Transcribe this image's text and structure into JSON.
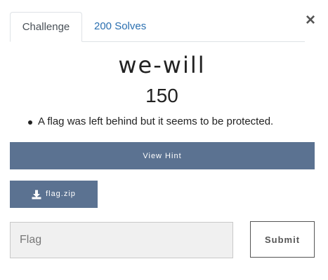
{
  "tabs": {
    "challenge_label": "Challenge",
    "solves_label": "200 Solves"
  },
  "close_label": "×",
  "challenge": {
    "name": "we-will",
    "points": "150",
    "description": "A flag was left behind but it seems to be protected."
  },
  "hint": {
    "button_label": "View Hint"
  },
  "file": {
    "label": "flag.zip",
    "icon": "download-icon"
  },
  "flag_form": {
    "placeholder": "Flag",
    "value": "",
    "submit_label": "Submit"
  },
  "colors": {
    "button_bg": "#5b7291",
    "link": "#2a6fb0"
  }
}
